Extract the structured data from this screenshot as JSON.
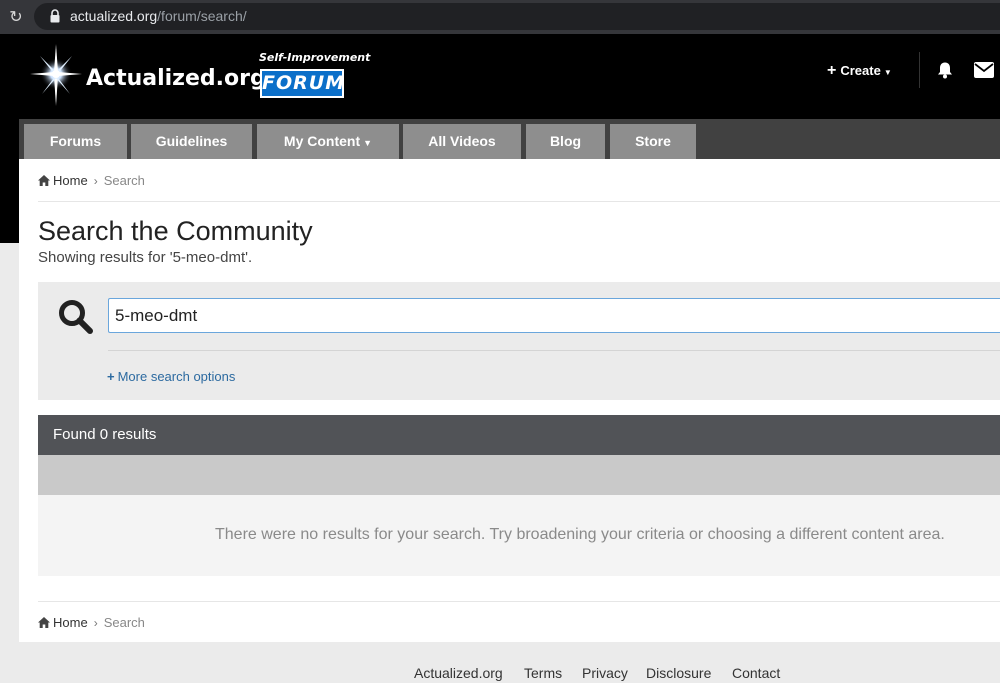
{
  "browser": {
    "reload_glyph": "↻",
    "url_host": "actualized.org",
    "url_path": "/forum/search/"
  },
  "header": {
    "site_name": "Actualized.org",
    "tagline": "Self-Improvement",
    "forum_badge": "FORUM",
    "create_label": "Create"
  },
  "nav": {
    "tabs": [
      {
        "label": "Forums"
      },
      {
        "label": "Guidelines"
      },
      {
        "label": "My Content"
      },
      {
        "label": "All Videos"
      },
      {
        "label": "Blog"
      },
      {
        "label": "Store"
      }
    ]
  },
  "breadcrumb": {
    "home": "Home",
    "current": "Search"
  },
  "main": {
    "title": "Search the Community",
    "subtitle": "Showing results for '5-meo-dmt'.",
    "search_value": "5-meo-dmt",
    "more_options": "More search options",
    "results_header": "Found 0 results",
    "no_results": "There were no results for your search. Try broadening your criteria or choosing a different content area."
  },
  "footer": {
    "links": [
      "Actualized.org",
      "Terms",
      "Privacy",
      "Disclosure",
      "Contact"
    ]
  },
  "colors": {
    "accent_blue": "#0b6fc9",
    "nav_tab": "#8e8e8e",
    "results_header": "#515357"
  },
  "icons": [
    "reload-icon",
    "lock-icon",
    "star-logo-icon",
    "plus-icon",
    "caret-down-icon",
    "bell-icon",
    "mail-icon",
    "home-icon",
    "search-icon"
  ]
}
